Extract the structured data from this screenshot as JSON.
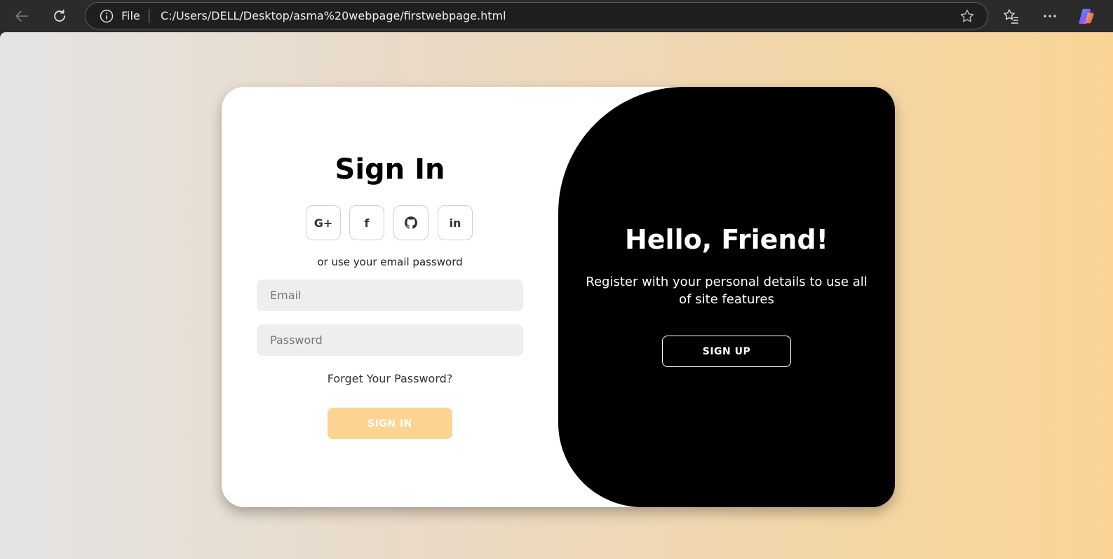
{
  "browser": {
    "file_label": "File",
    "url": "C:/Users/DELL/Desktop/asma%20webpage/firstwebpage.html",
    "icons": [
      "back-arrow-icon",
      "reload-icon",
      "info-icon",
      "star-icon",
      "favorites-icon",
      "more-icon",
      "copilot-icon"
    ]
  },
  "signin": {
    "title": "Sign In",
    "socials": [
      {
        "label": "G+",
        "icon": "google-plus-icon"
      },
      {
        "label": "f",
        "icon": "facebook-icon"
      },
      {
        "label": "",
        "icon": "github-icon"
      },
      {
        "label": "in",
        "icon": "linkedin-icon"
      }
    ],
    "alt_text": "or use your email password",
    "email_placeholder": "Email",
    "password_placeholder": "Password",
    "forgot": "Forget Your Password?",
    "button": "SIGN IN",
    "button_color": "#fdd392"
  },
  "panel": {
    "title": "Hello, Friend!",
    "text": "Register with your personal details to use all of site features",
    "button": "SIGN UP"
  },
  "colors": {
    "gradient_start": "#e4e4e4",
    "gradient_end": "#fbd495",
    "panel_bg": "#000000"
  }
}
